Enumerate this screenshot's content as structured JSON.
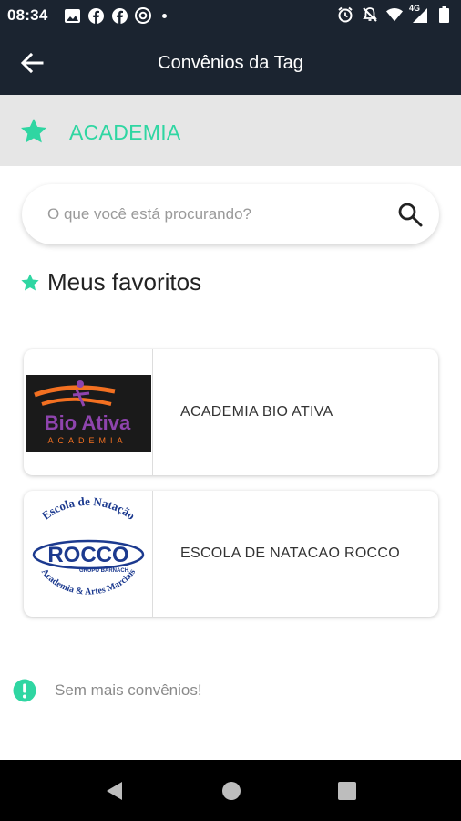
{
  "status_bar": {
    "time": "08:34",
    "network_label": "4G",
    "left_icons": [
      "image-icon",
      "facebook-icon",
      "facebook-icon",
      "at-sign-icon"
    ],
    "right_icons": [
      "alarm-icon",
      "notifications-off-icon",
      "wifi-icon",
      "cellular-signal-icon",
      "battery-icon"
    ]
  },
  "app_bar": {
    "title": "Convênios da Tag",
    "back_icon": "arrow-back-icon"
  },
  "category": {
    "label": "ACADEMIA",
    "icon": "star-icon"
  },
  "search": {
    "placeholder": "O que você está procurando?",
    "value": "",
    "icon": "search-icon"
  },
  "favorites": {
    "title": "Meus favoritos",
    "icon": "star-icon"
  },
  "cards": [
    {
      "name": "ACADEMIA BIO ATIVA",
      "logo": {
        "brand_name": "Bio Ativa",
        "subtitle": "ACADEMIA"
      }
    },
    {
      "name": "ESCOLA DE NATACAO ROCCO",
      "logo": {
        "arc_top": "Escola de Natação",
        "brand_name": "ROCCO",
        "tagline": "GRUPO BARNACH",
        "arc_bottom": "Academia & Artes Marciais"
      }
    }
  ],
  "footer_note": {
    "text": "Sem mais convênios!",
    "icon": "alert-circle-icon"
  },
  "nav_bar": {
    "buttons": [
      "nav-back-icon",
      "nav-home-icon",
      "nav-recents-icon"
    ]
  },
  "colors": {
    "app_bar_bg": "#1b2430",
    "accent": "#2fd6a2",
    "category_band_bg": "#e6e6e6"
  }
}
